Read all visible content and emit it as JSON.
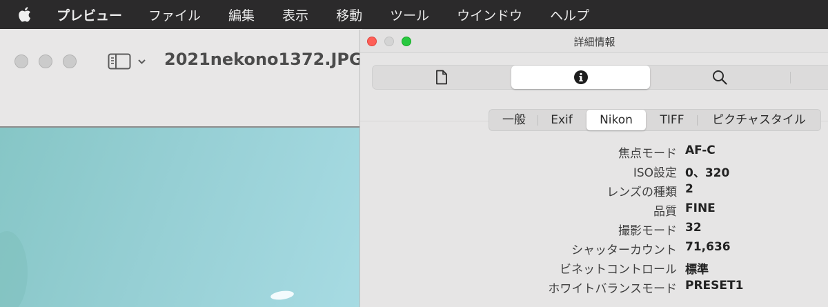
{
  "menubar": {
    "app_name": "プレビュー",
    "items": [
      "ファイル",
      "編集",
      "表示",
      "移動",
      "ツール",
      "ウインドウ",
      "ヘルプ"
    ]
  },
  "preview_window": {
    "title": "2021nekono1372.JPG",
    "icons": [
      "sidebar-icon",
      "chevron-down-icon"
    ]
  },
  "inspector": {
    "title": "詳細情報",
    "icon_tabs": [
      "document-icon",
      "info-icon",
      "search-icon"
    ],
    "selected_icon_tab": "info-icon",
    "sections": [
      "一般",
      "Exif",
      "Nikon",
      "TIFF",
      "ピクチャスタイル"
    ],
    "selected_section": "Nikon",
    "properties": [
      {
        "label": "焦点モード",
        "value": "AF-C"
      },
      {
        "label": "ISO設定",
        "value": "0、320"
      },
      {
        "label": "レンズの種類",
        "value": "2"
      },
      {
        "label": "品質",
        "value": "FINE"
      },
      {
        "label": "撮影モード",
        "value": "32"
      },
      {
        "label": "シャッターカウント",
        "value": "71,636"
      },
      {
        "label": "ビネットコントロール",
        "value": "標準"
      },
      {
        "label": "ホワイトバランスモード",
        "value": "PRESET1"
      }
    ]
  },
  "colors": {
    "menubar": "#2b2a2b",
    "close": "#fe5f57",
    "zoom": "#28c840",
    "photo": "#9fd6dc"
  }
}
